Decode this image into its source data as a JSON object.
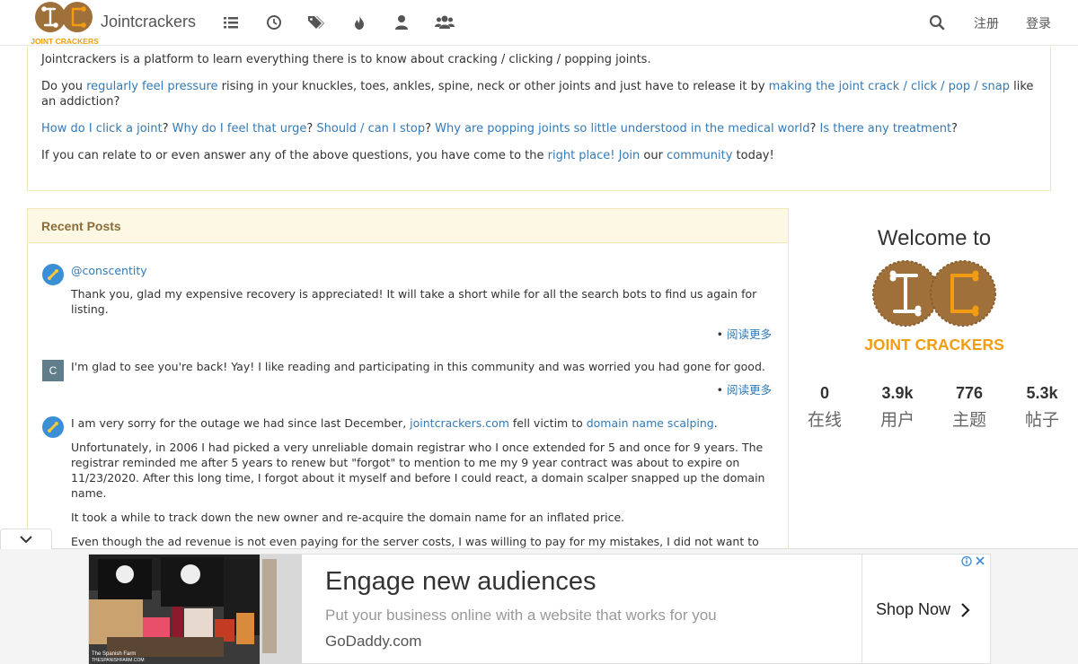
{
  "nav": {
    "brand": "Jointcrackers",
    "logo_text": "JOINT CRACKERS",
    "register": "注册",
    "login": "登录"
  },
  "intro": {
    "p1": "Jointcrackers is a platform to learn everything there is to know about cracking / clicking / popping joints.",
    "p2_pre": "Do you ",
    "p2_link1": "regularly feel pressure",
    "p2_mid": " rising in your knuckles, toes, ankles, spine, neck or other joints and just have to release it by ",
    "p2_link2": "making the joint crack / click / pop / snap",
    "p2_post": " like an addiction?",
    "q1": "How do I click a joint",
    "q2": "Why do I feel that urge",
    "q3": "Should / can I stop",
    "q4": "Why are popping joints so little understood in the medical world",
    "q5": "Is there any treatment",
    "p4_pre": "If you can relate to or even answer any of the above questions, you have come to the ",
    "p4_link1": "right place!",
    "p4_link2": "Join",
    "p4_mid": " our ",
    "p4_link3": "community",
    "p4_post": " today!"
  },
  "recent": {
    "title": "Recent Posts",
    "read_more": "阅读更多",
    "post1_mention": "@conscentity",
    "post1_text": "Thank you, glad my expensive recovery is appreciated! It will take a short while for all the search bots to find us again for listing.",
    "post2_avatar": "C",
    "post2_text": "I'm glad to see you're back! Yay! I like reading and participating in this community and was worried you had gone for good.",
    "post3_pre": "I am very sorry for the outage we had since last December, ",
    "post3_link1": "jointcrackers.com",
    "post3_mid": " fell victim to ",
    "post3_link2": "domain name scalping",
    "post3_p2": "Unfortunately, in 2006 I had picked a very unreliable domain registrar who I once extended for 5 and once for 9 years. The registrar reminded me after 5 years to renew but \"forgot\" to mention to me my 9 year contract was about to expire on 11/23/2020. After this long time, I forgot about it myself and before I could react, a domain scalper snapped up the domain name.",
    "post3_p3": "It took a while to track down the new owner and re-acquire the domain name for an inflated price.",
    "post3_p4": "Even though the ad revenue is not even paying for the server costs, I was willing to pay for my mistakes, I did not want to"
  },
  "sidebar": {
    "welcome": "Welcome to",
    "logo_text": "JOINT CRACKERS",
    "stats": [
      {
        "value": "0",
        "label": "在线"
      },
      {
        "value": "3.9k",
        "label": "用户"
      },
      {
        "value": "776",
        "label": "主题"
      },
      {
        "value": "5.3k",
        "label": "帖子"
      }
    ]
  },
  "ad": {
    "title": "Engage new audiences",
    "subtitle": "Put your business online with a website that works for you",
    "domain": "GoDaddy.com",
    "cta": "Shop Now",
    "image_caption": "The Spanish Farm",
    "image_caption2": "THESPANISHFARM.COM"
  },
  "colors": {
    "link": "#337ab7",
    "panel_heading_bg": "#fcf8e3",
    "panel_border": "#f0e6b8",
    "logo_brown": "#a0703a",
    "logo_orange": "#f39c12"
  }
}
